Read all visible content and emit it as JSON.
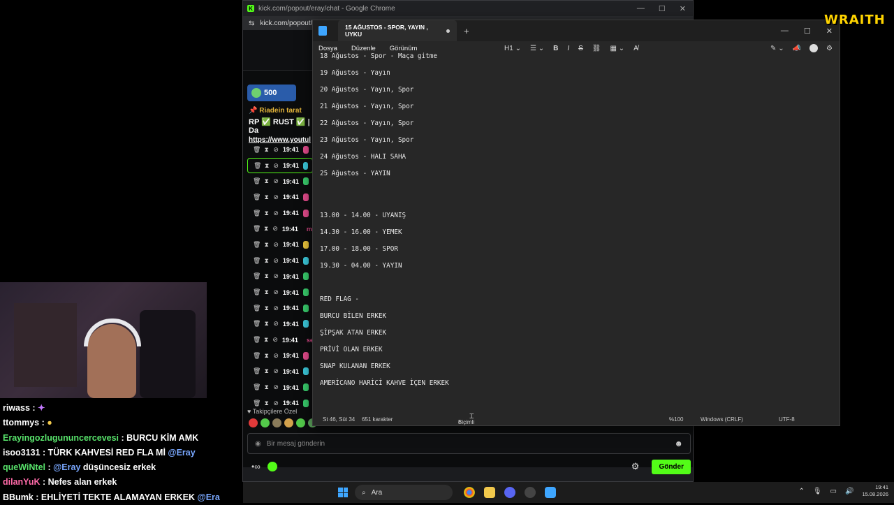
{
  "chrome": {
    "title": "kick.com/popout/eray/chat - Google Chrome",
    "url": "kick.com/popout/",
    "balance": "500",
    "pinned": {
      "author_line": "Riadein tarat",
      "title_line": "RP ✅ RUST ✅ | Da",
      "link": "https://www.youtul"
    },
    "mod_rows": [
      {
        "time": "19:41",
        "name": ""
      },
      {
        "time": "19:41",
        "name": ""
      },
      {
        "time": "19:41",
        "name": ""
      },
      {
        "time": "19:41",
        "name": ""
      },
      {
        "time": "19:41",
        "name": ""
      },
      {
        "time": "19:41",
        "name": "mel"
      },
      {
        "time": "19:41",
        "name": ""
      },
      {
        "time": "19:41",
        "name": ""
      },
      {
        "time": "19:41",
        "name": ""
      },
      {
        "time": "19:41",
        "name": ""
      },
      {
        "time": "19:41",
        "name": ""
      },
      {
        "time": "19:41",
        "name": ""
      },
      {
        "time": "19:41",
        "name": "seyi"
      },
      {
        "time": "19:41",
        "name": ""
      },
      {
        "time": "19:41",
        "name": ""
      },
      {
        "time": "19:41",
        "name": ""
      },
      {
        "time": "19:41",
        "name": ""
      }
    ],
    "follower_only": "Takipçilere Özel",
    "message_placeholder": "Bir mesaj gönderin",
    "send_label": "Gönder"
  },
  "overlay_chat": [
    {
      "user": "riwass",
      "text": ""
    },
    {
      "user": "ttommys",
      "text": ""
    },
    {
      "user": "Erayingozlugununcercevesi",
      "text": "BURCU KİM AMK"
    },
    {
      "user": "isoo3131",
      "text": "TÜRK KAHVESİ RED FLA Mİ",
      "mention": "@Eray"
    },
    {
      "user": "queWiNtel",
      "mention_first": "@Eray",
      "text": "düşüncesiz erkek"
    },
    {
      "user": "dilanYuK",
      "text": "Nefes alan erkek"
    },
    {
      "user": "BBumk",
      "text": "EHLİYETİ TEKTE ALAMAYAN ERKEK",
      "mention": "@Era"
    }
  ],
  "notepad": {
    "tab_title": "15 AĞUSTOS - SPOR, YAYIN , UYKU",
    "menu": [
      "Dosya",
      "Düzenle",
      "Görünüm"
    ],
    "heading_dropdown": "H1",
    "lines": [
      "18 Ağustos - Spor - Maça gitme",
      "19 Ağustos - Yayın",
      "20 Ağustos - Yayın, Spor",
      "21 Ağustos - Yayın, Spor",
      "22 Ağustos - Yayın, Spor",
      "23 Ağustos - Yayın, Spor",
      "24 Ağustos - HALI SAHA",
      "25 Ağustos - YAYIN",
      "",
      "13.00 - 14.00 - UYANIŞ",
      "14.30 - 16.00 - YEMEK",
      "17.00 - 18.00 - SPOR",
      "19.30 - 04.00 - YAYIN",
      "",
      "RED FLAG -",
      "BURCU BİLEN ERKEK",
      "ŞİPŞAK ATAN ERKEK",
      "PRİVİ OLAN ERKEK",
      "SNAP KULANAN ERKEK",
      "AMERİCANO HARİCİ KAHVE İÇEN ERKEK"
    ],
    "status": {
      "position": "St 46, Süt 34",
      "chars": "651 karakter",
      "format": "Biçimli",
      "zoom": "%100",
      "line_ending": "Windows (CRLF)",
      "encoding": "UTF-8"
    }
  },
  "overlay_logo": "WRAITH",
  "taskbar": {
    "search_label": "Ara",
    "time": "19:41",
    "date": "15.08.2026"
  },
  "colors": {
    "kick_green": "#53fc18",
    "logo_yellow": "#ffd400"
  }
}
